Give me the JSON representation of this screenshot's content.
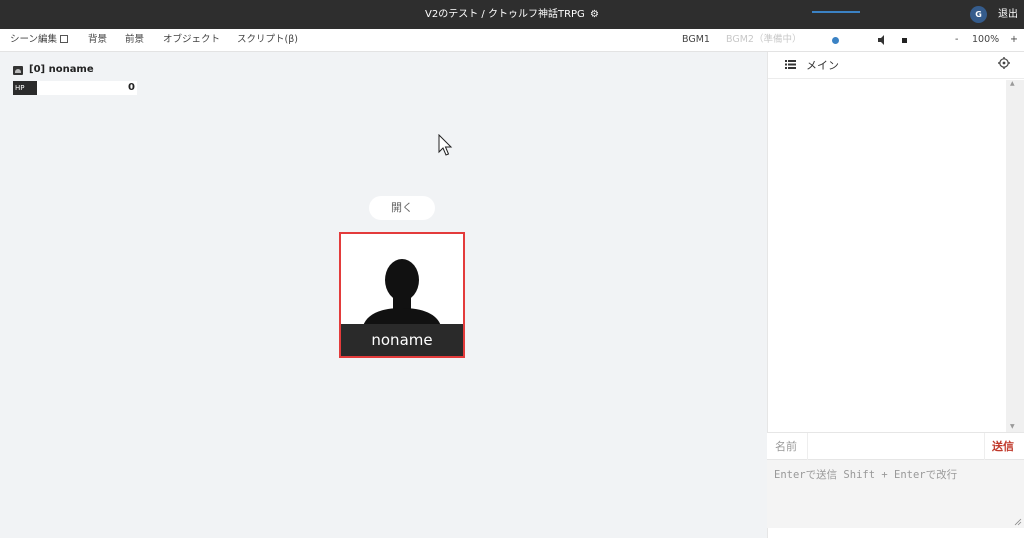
{
  "titlebar": {
    "title": "V2のテスト / クトゥルフ神話TRPG",
    "title_icon": "gear-icon",
    "avatar_initial": "G",
    "exit_label": "退出"
  },
  "menubar": {
    "scene_edit": "シーン編集",
    "background": "背景",
    "foreground": "前景",
    "object": "オブジェクト",
    "script": "スクリプト(β)",
    "bgm1": "BGM1",
    "bgm2": "BGM2（準備中）",
    "zoom_minus": "-",
    "zoom_value": "100%",
    "zoom_plus": "+"
  },
  "token_status": {
    "name": "[0] noname",
    "hp_label": "HP",
    "hp_value": "0"
  },
  "stage": {
    "open_button": "開く",
    "character_name": "noname"
  },
  "chat": {
    "tab_name": "メイン",
    "name_label": "名前",
    "send_label": "送信",
    "message_placeholder": "Enterで送信 Shift + Enterで改行"
  },
  "colors": {
    "titlebar_bg": "#2e2e2e",
    "card_border": "#e33b3b",
    "send_text": "#c0392b",
    "slider_accent": "#3b82c4"
  }
}
